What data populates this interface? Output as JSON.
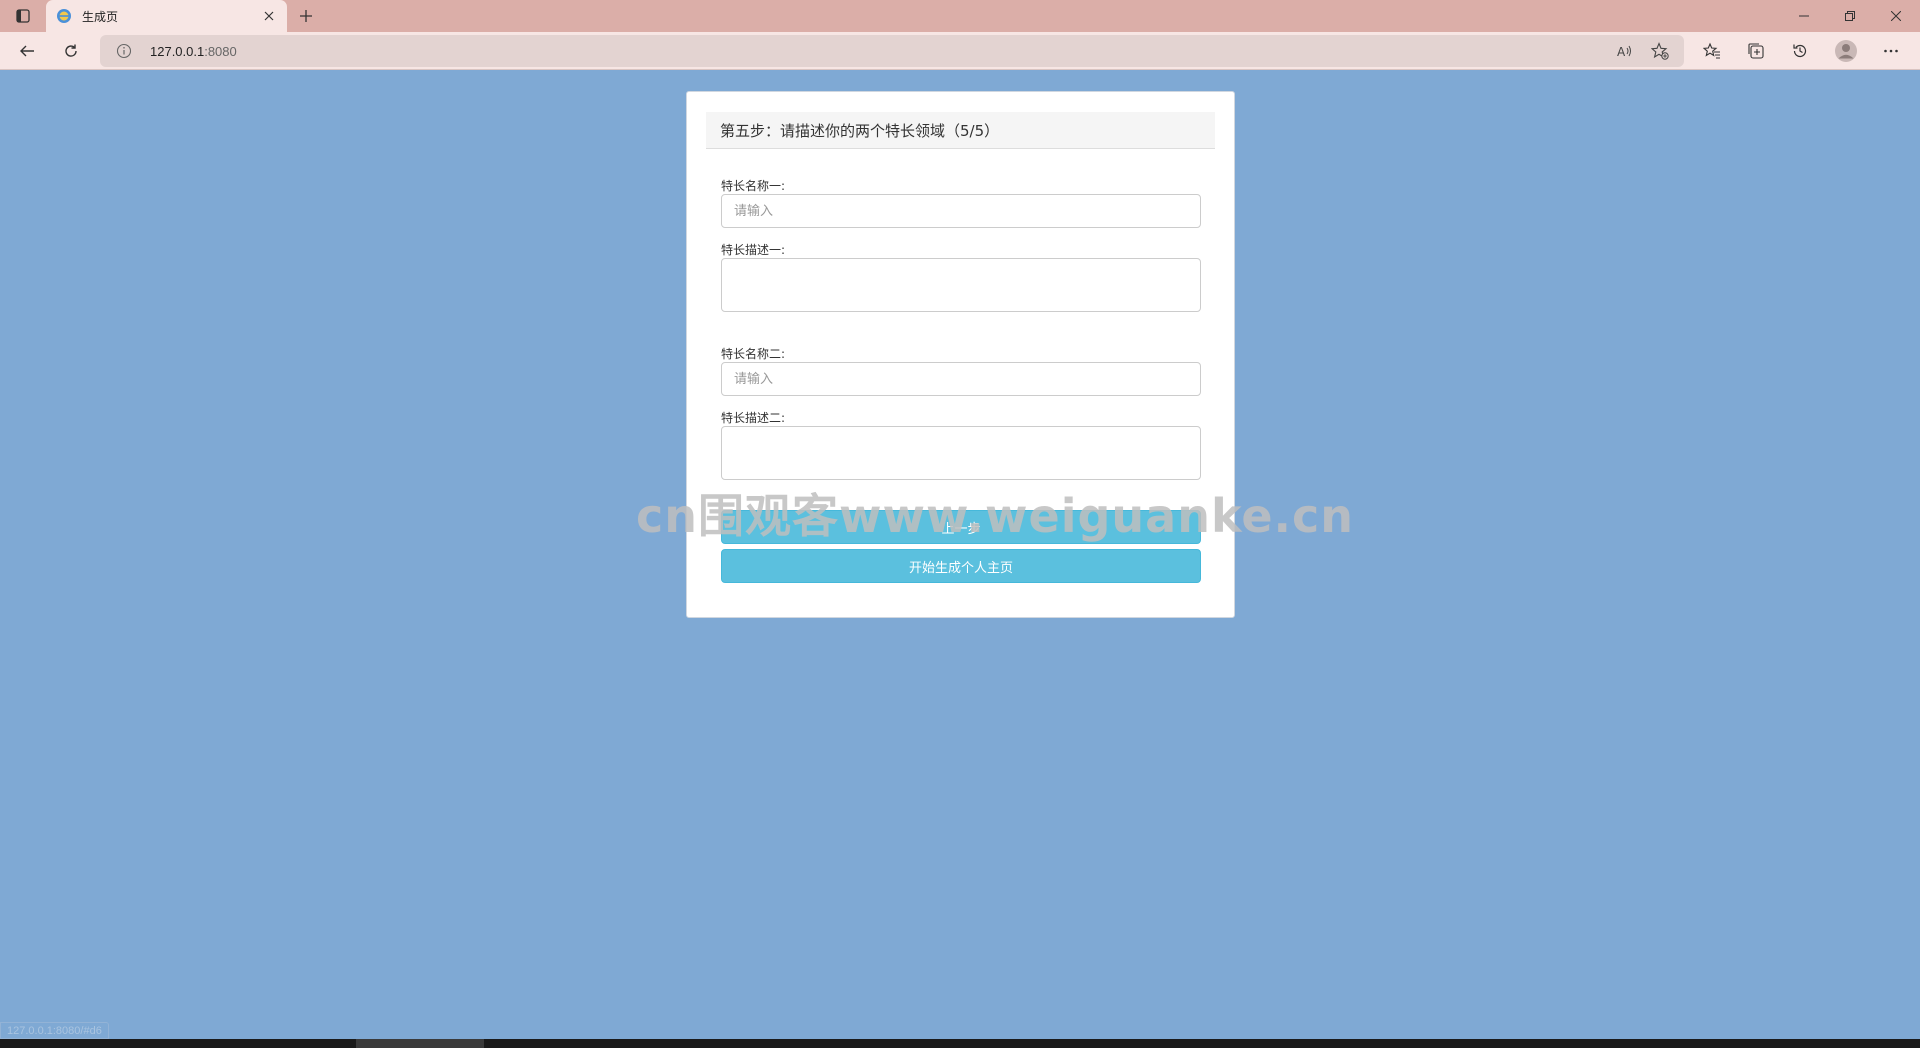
{
  "browser": {
    "tab_title": "生成页",
    "url_host": "127.0.0.1",
    "url_port": ":8080",
    "status_url": "127.0.0.1:8080/#d6"
  },
  "form": {
    "heading": "第五步：请描述你的两个特长领域（5/5）",
    "skill1_name_label": "特长名称一:",
    "skill1_name_placeholder": "请输入",
    "skill1_desc_label": "特长描述一:",
    "skill2_name_label": "特长名称二:",
    "skill2_name_placeholder": "请输入",
    "skill2_desc_label": "特长描述二:",
    "prev_button": "上一步",
    "generate_button": "开始生成个人主页"
  },
  "watermark": "cn围观客www.weiguanke.cn",
  "colors": {
    "page_bg": "#7fa9d4",
    "button": "#5bc0de",
    "tabbar": "#dbaea8"
  }
}
